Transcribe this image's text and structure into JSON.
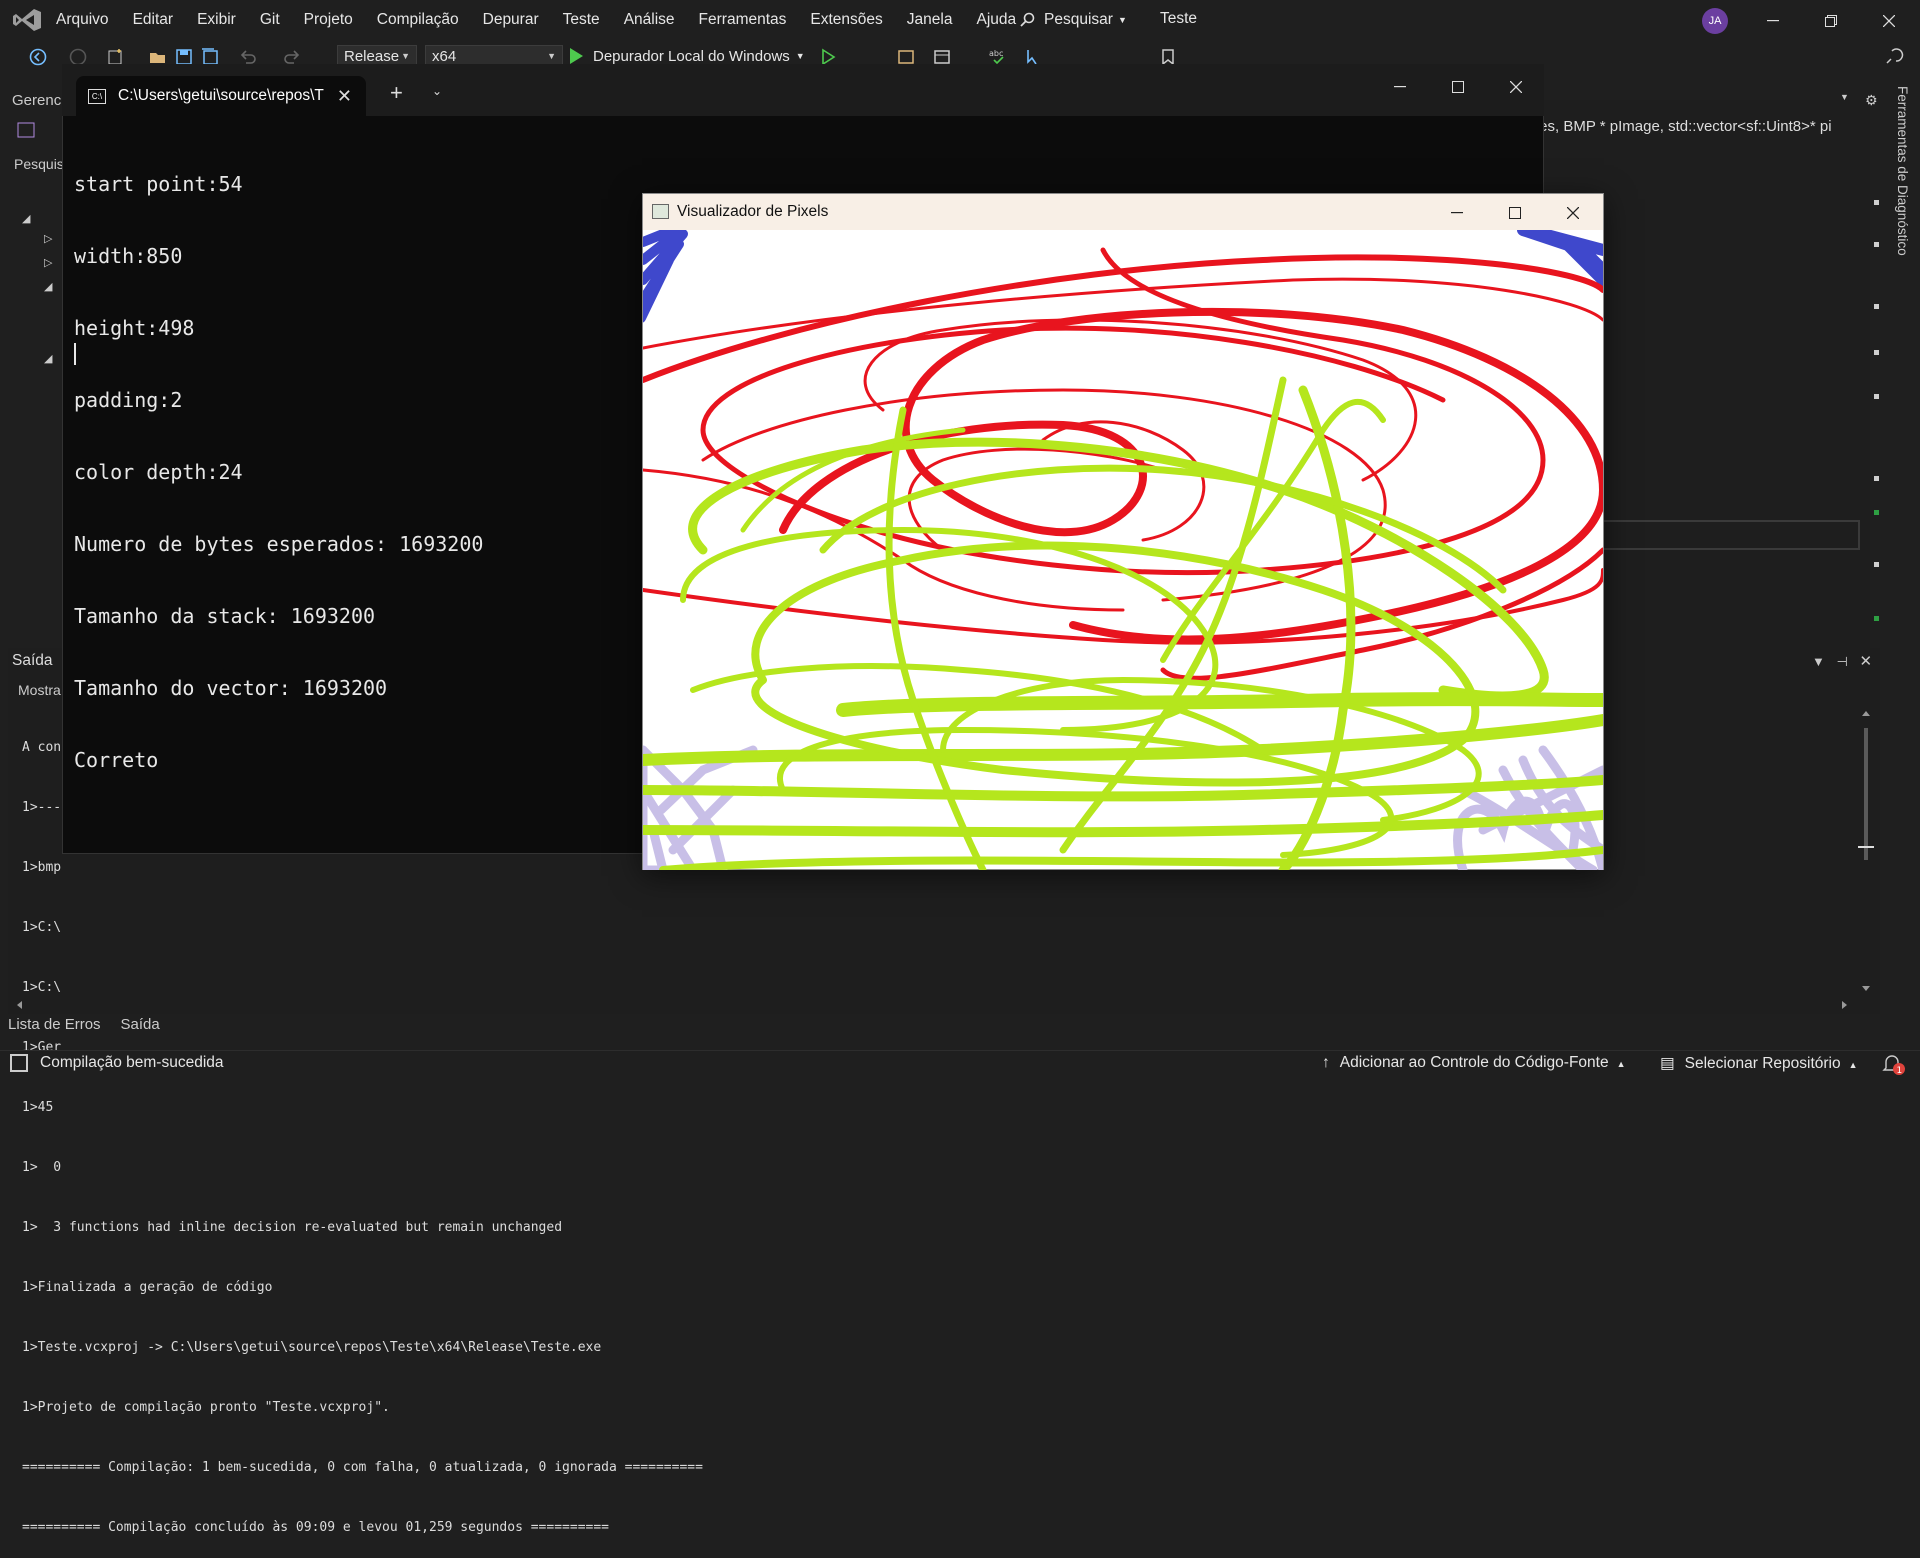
{
  "menubar": {
    "items": [
      "Arquivo",
      "Editar",
      "Exibir",
      "Git",
      "Projeto",
      "Compilação",
      "Depurar",
      "Teste",
      "Análise",
      "Ferramentas",
      "Extensões",
      "Janela",
      "Ajuda"
    ],
    "search_label": "Pesquisar",
    "solution_name": "Teste",
    "avatar_initials": "JA"
  },
  "toolbar": {
    "configuration": "Release",
    "platform": "x64",
    "run_label": "Depurador Local do Windows"
  },
  "left_dock": {
    "explorer_tab": "Gerenci",
    "search_tab": "Pesquis"
  },
  "editor": {
    "nav_text": "tes, BMP * pImage, std::vector<sf::Uint8>* pi",
    "diagnostics_tab": "Ferramentas de Diagnóstico"
  },
  "console": {
    "tab_title": "C:\\Users\\getui\\source\\repos\\T",
    "lines": [
      "start point:54",
      "width:850",
      "height:498",
      "padding:2",
      "color depth:24",
      "Numero de bytes esperados: 1693200",
      "Tamanho da stack: 1693200",
      "Tamanho do vector: 1693200",
      "Correto"
    ]
  },
  "viewer": {
    "title": "Visualizador de Pixels"
  },
  "output": {
    "title": "Saída",
    "show_label": "Mostra",
    "lines": [
      "A con",
      "1>---",
      "1>bmp",
      "1>C:\\",
      "1>C:\\",
      "1>Ger",
      "1>45",
      "1>  0",
      "1>  3 functions had inline decision re-evaluated but remain unchanged",
      "1>Finalizada a geração de código",
      "1>Teste.vcxproj -> C:\\Users\\getui\\source\\repos\\Teste\\x64\\Release\\Teste.exe",
      "1>Projeto de compilação pronto \"Teste.vcxproj\".",
      "========== Compilação: 1 bem-sucedida, 0 com falha, 0 atualizada, 0 ignorada ==========",
      "========== Compilação concluído às 09:09 e levou 01,259 segundos =========="
    ]
  },
  "bottom_tabs": [
    "Lista de Erros",
    "Saída"
  ],
  "statusbar": {
    "message": "Compilação bem-sucedida",
    "source_control": "Adicionar ao Controle do Código-Fonte",
    "select_repo": "Selecionar Repositório",
    "notifications": "1"
  },
  "colors": {
    "vs_background": "#1f1f1f",
    "console_background": "#0c0c0c",
    "stroke_red": "#e8141e",
    "stroke_lime": "#b5e61d",
    "stroke_blue": "#3f48cc",
    "stroke_lavender": "#c8bfe7"
  }
}
